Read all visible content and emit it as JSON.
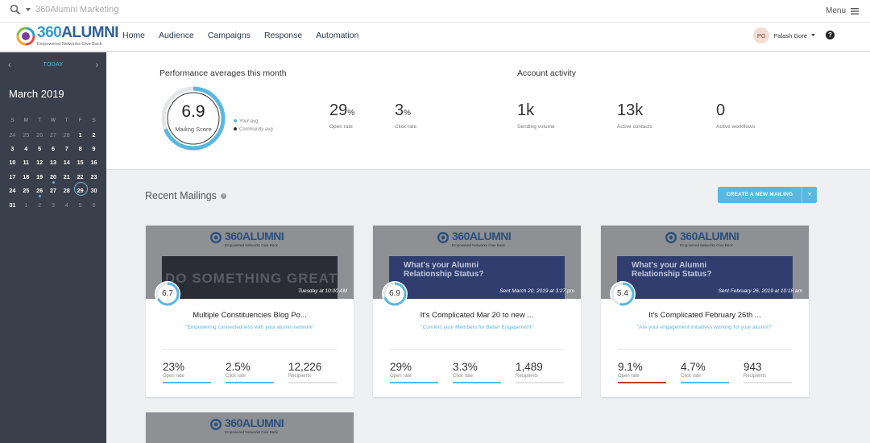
{
  "topbar": {
    "search_text": "360Alumni Marketing",
    "menu_label": "Menu"
  },
  "logo": {
    "brand_a": "360",
    "brand_b": "ALUMNI",
    "tagline": "Empowered Networks Give Back"
  },
  "nav": {
    "items": [
      "Home",
      "Audience",
      "Campaigns",
      "Response",
      "Automation"
    ]
  },
  "user": {
    "initials": "PG",
    "name": "Palash Gore"
  },
  "calendar": {
    "today_label": "TODAY",
    "month": "March 2019",
    "dow": [
      "S",
      "M",
      "T",
      "W",
      "T",
      "F",
      "S"
    ],
    "weeks": [
      [
        "24",
        "25",
        "26",
        "27",
        "28",
        "1",
        "2"
      ],
      [
        "3",
        "4",
        "5",
        "6",
        "7",
        "8",
        "9"
      ],
      [
        "10",
        "11",
        "12",
        "13",
        "14",
        "15",
        "16"
      ],
      [
        "17",
        "18",
        "19",
        "20",
        "21",
        "22",
        "23"
      ],
      [
        "24",
        "25",
        "26",
        "27",
        "28",
        "29",
        "30"
      ],
      [
        "31",
        "1",
        "2",
        "3",
        "4",
        "5",
        "6"
      ]
    ]
  },
  "performance": {
    "title": "Performance averages this month",
    "score": "6.9",
    "score_label": "Mailing Score",
    "score_fraction": 0.69,
    "legend_your": "Your avg",
    "legend_community": "Community avg",
    "open_rate": "29",
    "open_rate_unit": "%",
    "open_rate_label": "Open rate",
    "click_rate": "3",
    "click_rate_unit": "%",
    "click_rate_label": "Click rate"
  },
  "activity": {
    "title": "Account activity",
    "sending_volume": "1k",
    "sending_volume_label": "Sending volume",
    "active_contacts": "13k",
    "active_contacts_label": "Active contacts",
    "active_workflows": "0",
    "active_workflows_label": "Active workflows"
  },
  "recent": {
    "title": "Recent Mailings",
    "create_label": "CREATE A NEW MAILING",
    "mailings": [
      {
        "score": "6.7",
        "score_fraction": 0.67,
        "sent": "Tuesday at 10:00 AM",
        "title": "Multiple Constituencies Blog Po...",
        "subtitle": "\"Empowering connectedness with your alumni network\"",
        "thumb_text": "DO SOMETHING GREAT",
        "open_rate": "23%",
        "open_fraction": 1.0,
        "open_color": "#5ab8e0",
        "click_rate": "2.5%",
        "click_fraction": 1.0,
        "recipients": "12,226",
        "labels": [
          "Open rate",
          "Click rate",
          "Recipients"
        ]
      },
      {
        "score": "6.9",
        "score_fraction": 0.69,
        "sent": "Sent March 20, 2019 at 3:27 pm",
        "title": "It's Complicated Mar 20 to new ...",
        "subtitle": "\"Connect your Members for Better Engagement\"",
        "thumb_text": "What's your Alumni Relationship Status?",
        "open_rate": "29%",
        "open_fraction": 1.0,
        "open_color": "#5ab8e0",
        "click_rate": "3.3%",
        "click_fraction": 1.0,
        "recipients": "1,489",
        "labels": [
          "Open rate",
          "Click rate",
          "Recipients"
        ]
      },
      {
        "score": "5.4",
        "score_fraction": 0.54,
        "sent": "Sent February 26, 2019 at 10:18 am",
        "title": "It's Complicated February 26th ...",
        "subtitle": "\"Are your engagement initiatives working for your alumni?\"",
        "thumb_text": "What's your Alumni Relationship Status?",
        "open_rate": "9.1%",
        "open_fraction": 1.0,
        "open_color": "#c0392b",
        "click_rate": "4.7%",
        "click_fraction": 1.0,
        "recipients": "943",
        "labels": [
          "Open rate",
          "Click rate",
          "Recipients"
        ]
      }
    ]
  },
  "colors": {
    "accent": "#5ab8e0",
    "sidebar": "#3a404b",
    "community": "#333333",
    "warning": "#c0392b"
  }
}
